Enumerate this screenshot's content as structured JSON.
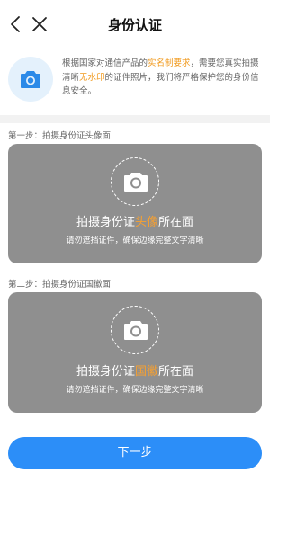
{
  "header": {
    "title": "身份认证"
  },
  "intro": {
    "text_part1": "根据国家对通信产品的",
    "highlight1": "实名制要求",
    "text_part2": "，需要您真实拍摄清晰",
    "highlight2": "无水印",
    "text_part3": "的证件照片，我们将严格保护您的身份信息安全。"
  },
  "step1": {
    "label": "第一步：拍摄身份证头像面",
    "main_prefix": "拍摄身份证",
    "main_highlight": "头像",
    "main_suffix": "所在面",
    "sub": "请勿遮挡证件，确保边缘完整文字清晰"
  },
  "step2": {
    "label": "第二步：拍摄身份证国徽面",
    "main_prefix": "拍摄身份证",
    "main_highlight": "国徽",
    "main_suffix": "所在面",
    "sub": "请勿遮挡证件，确保边缘完整文字清晰"
  },
  "next_button": {
    "label": "下一步"
  },
  "colors": {
    "accent": "#2c8ef8",
    "highlight": "#f19a1e",
    "card_bg": "#8f8f8f",
    "icon_blue": "#2b8ae8"
  },
  "icons": [
    "back-arrow",
    "close",
    "camera"
  ]
}
